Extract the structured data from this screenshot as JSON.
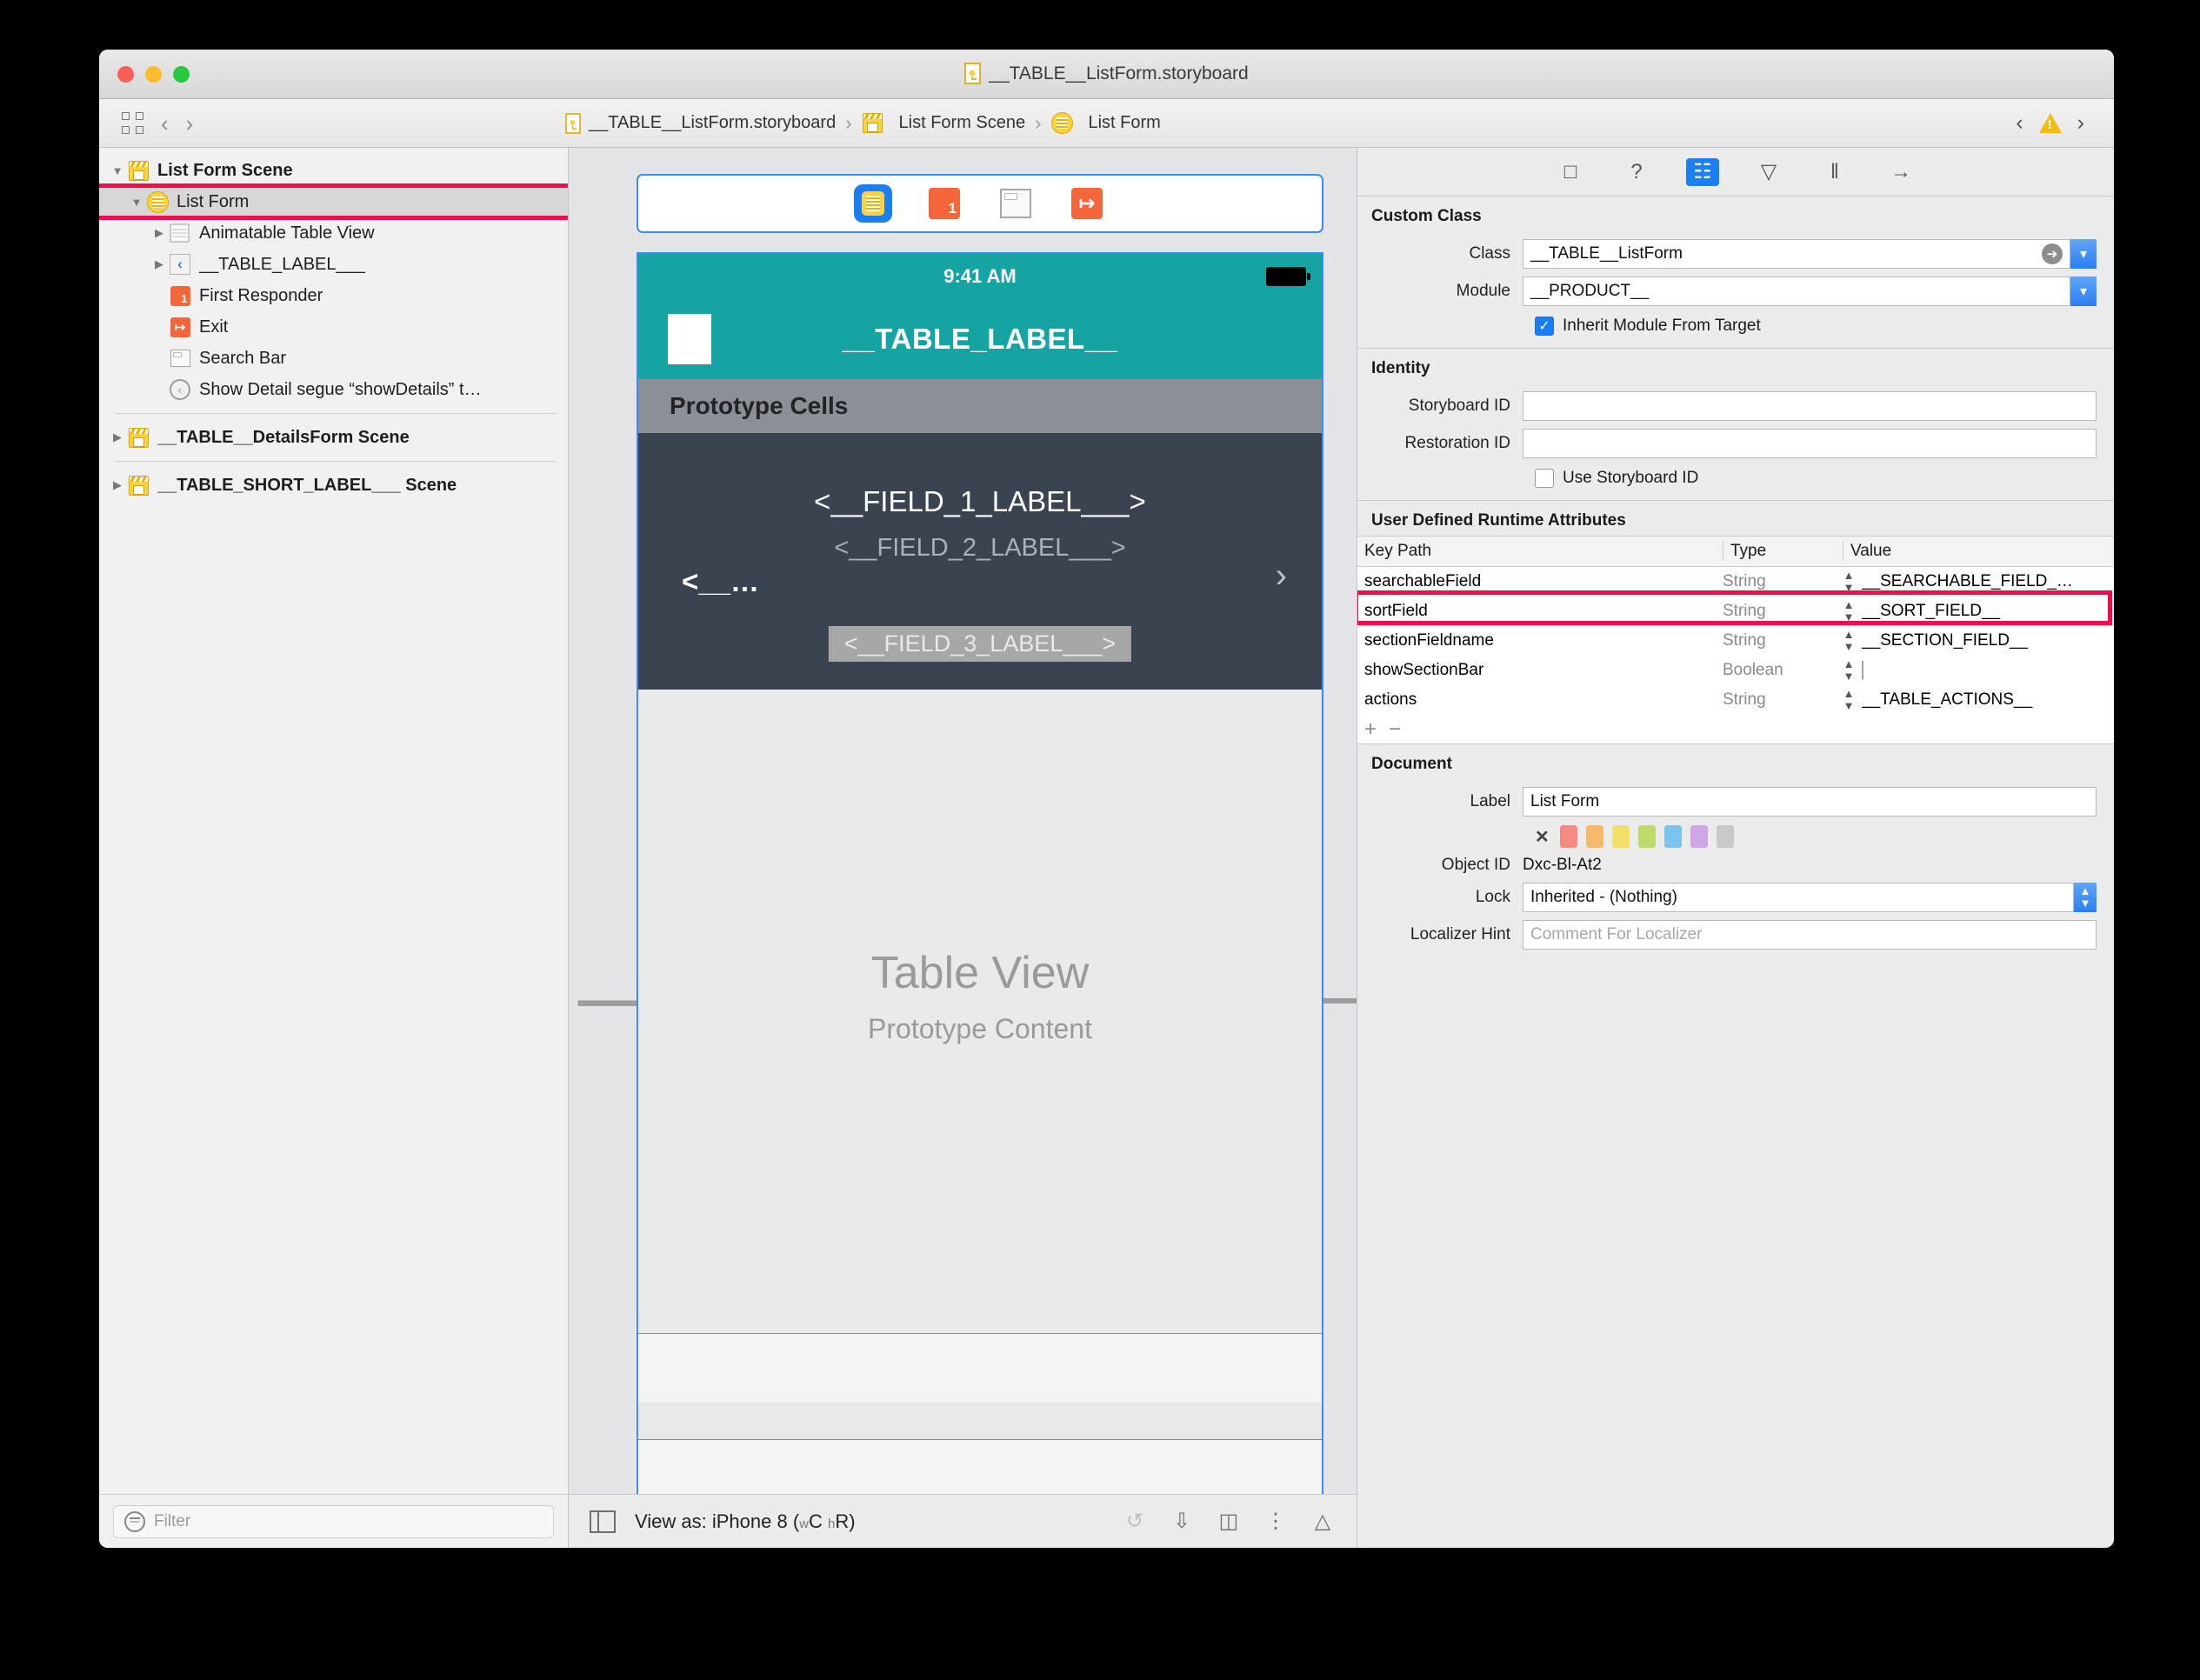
{
  "window": {
    "title": "__TABLE__ListForm.storyboard"
  },
  "breadcrumb": {
    "items": [
      {
        "label": "__TABLE__ListForm.storyboard",
        "icon": "storyboard-file-icon"
      },
      {
        "label": "List Form Scene",
        "icon": "scene-icon"
      },
      {
        "label": "List Form",
        "icon": "view-controller-icon"
      }
    ],
    "separator": "›",
    "back_glyph": "‹",
    "forward_glyph": "›",
    "warning_glyph": "!"
  },
  "outline": {
    "rows": [
      {
        "label": "List Form Scene",
        "indent": 0,
        "twisty": "▼",
        "icon": "scene-icon",
        "bold": true,
        "selected": false
      },
      {
        "label": "List Form",
        "indent": 1,
        "twisty": "▼",
        "icon": "view-controller-icon",
        "bold": false,
        "selected": true
      },
      {
        "label": "Animatable Table View",
        "indent": 2,
        "twisty": "▶",
        "icon": "table-view-icon",
        "bold": false,
        "selected": false
      },
      {
        "label": "__TABLE_LABEL___",
        "indent": 2,
        "twisty": "▶",
        "icon": "navigation-item-icon",
        "bold": false,
        "selected": false
      },
      {
        "label": "First Responder",
        "indent": 2,
        "twisty": "",
        "icon": "first-responder-icon",
        "bold": false,
        "selected": false
      },
      {
        "label": "Exit",
        "indent": 2,
        "twisty": "",
        "icon": "exit-icon",
        "bold": false,
        "selected": false
      },
      {
        "label": "Search Bar",
        "indent": 2,
        "twisty": "",
        "icon": "search-bar-icon",
        "bold": false,
        "selected": false
      },
      {
        "label": "Show Detail segue “showDetails” t…",
        "indent": 2,
        "twisty": "",
        "icon": "segue-icon",
        "bold": false,
        "selected": false
      }
    ],
    "scenes": [
      {
        "label": "__TABLE__DetailsForm Scene",
        "twisty": "▶",
        "icon": "scene-icon"
      },
      {
        "label": "__TABLE_SHORT_LABEL___ Scene",
        "twisty": "▶",
        "icon": "scene-icon"
      }
    ],
    "filter_placeholder": "Filter"
  },
  "canvas": {
    "scene_bar_icons": [
      "view-controller-icon",
      "first-responder-icon",
      "window-icon",
      "exit-icon"
    ],
    "phone": {
      "status_time": "9:41 AM",
      "nav_title": "__TABLE_LABEL__",
      "prototype_cells_header": "Prototype Cells",
      "field_1": "<__FIELD_1_LABEL___>",
      "field_2": "<__FIELD_2_LABEL___>",
      "field_left": "<__…",
      "field_right": "›",
      "field_3": "<__FIELD_3_LABEL___>",
      "table_view_title": "Table View",
      "table_view_subtitle": "Prototype Content"
    },
    "footer": {
      "view_as_label": "View as: iPhone 8 (",
      "view_as_w": "w",
      "view_as_c": "C",
      "view_as_h": "h",
      "view_as_r": "R)",
      "icons": [
        "update-frames-icon",
        "embed-in-icon",
        "align-icon",
        "pin-icon",
        "resolve-issues-icon"
      ]
    }
  },
  "inspector": {
    "tabs": [
      {
        "name": "file-inspector-icon",
        "glyph": "□",
        "active": false
      },
      {
        "name": "quick-help-icon",
        "glyph": "?",
        "active": false
      },
      {
        "name": "identity-inspector-icon",
        "glyph": "☷",
        "active": true
      },
      {
        "name": "attributes-inspector-icon",
        "glyph": "▽",
        "active": false
      },
      {
        "name": "size-inspector-icon",
        "glyph": "‖",
        "active": false
      },
      {
        "name": "connections-inspector-icon",
        "glyph": "→",
        "active": false
      }
    ],
    "custom_class": {
      "title": "Custom Class",
      "class_label": "Class",
      "class_value": "__TABLE__ListForm",
      "module_label": "Module",
      "module_value": "__PRODUCT__",
      "inherit_label": "Inherit Module From Target",
      "inherit_checked": true
    },
    "identity": {
      "title": "Identity",
      "storyboard_id_label": "Storyboard ID",
      "storyboard_id_value": "",
      "restoration_id_label": "Restoration ID",
      "restoration_id_value": "",
      "use_storyboard_id_label": "Use Storyboard ID",
      "use_storyboard_id_checked": false
    },
    "runtime_attributes": {
      "title": "User Defined Runtime Attributes",
      "columns": [
        "Key Path",
        "Type",
        "Value"
      ],
      "rows": [
        {
          "key": "searchableField",
          "type": "String",
          "value": "__SEARCHABLE_FIELD_…",
          "bool": false,
          "highlight": false
        },
        {
          "key": "sortField",
          "type": "String",
          "value": "__SORT_FIELD__",
          "bool": false,
          "highlight": false
        },
        {
          "key": "sectionFieldname",
          "type": "String",
          "value": "__SECTION_FIELD__",
          "bool": false,
          "highlight": false
        },
        {
          "key": "showSectionBar",
          "type": "Boolean",
          "value": "",
          "bool": true,
          "highlight": false
        },
        {
          "key": "actions",
          "type": "String",
          "value": "__TABLE_ACTIONS__",
          "bool": false,
          "highlight": true
        }
      ],
      "add_glyph": "+",
      "remove_glyph": "−"
    },
    "document": {
      "title": "Document",
      "label_label": "Label",
      "label_value": "List Form",
      "swatch_clear": "✕",
      "swatches": [
        "#f78b82",
        "#f7b96a",
        "#f3e06a",
        "#bcdb6a",
        "#7cc3f0",
        "#cfa6e8",
        "#c9c9c9"
      ],
      "object_id_label": "Object ID",
      "object_id_value": "Dxc-Bl-At2",
      "lock_label": "Lock",
      "lock_value": "Inherited - (Nothing)",
      "localizer_hint_label": "Localizer Hint",
      "localizer_hint_placeholder": "Comment For Localizer"
    }
  },
  "highlight_color": "#f50a4d"
}
